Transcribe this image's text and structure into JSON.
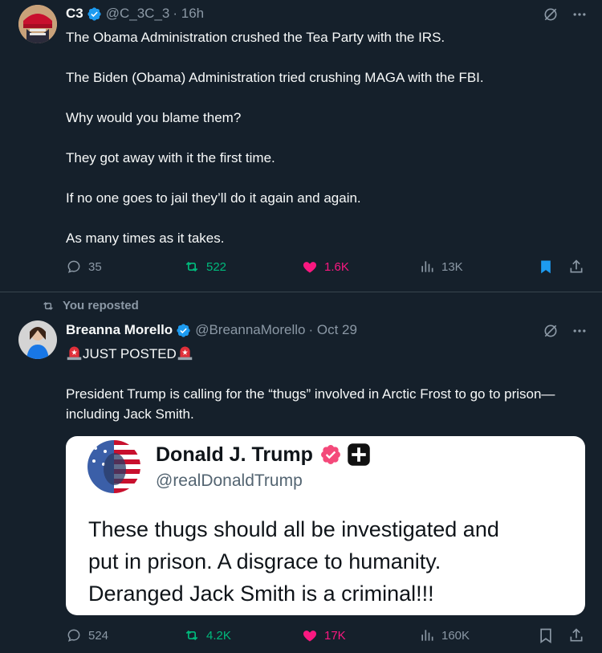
{
  "posts": [
    {
      "display_name": "C3",
      "handle": "@C_3C_3",
      "time": "· 16h",
      "lines": [
        "The Obama Administration crushed the Tea Party with the IRS.",
        "The Biden (Obama) Administration tried crushing MAGA with the FBI.",
        "Why would you blame them?",
        "They got away with it the first time.",
        "If no one goes to jail they’ll do it again and again.",
        "As many times as it takes."
      ],
      "actions": {
        "replies": "35",
        "reposts": "522",
        "likes": "1.6K",
        "views": "13K"
      }
    },
    {
      "repost_label": "You reposted",
      "display_name": "Breanna Morello",
      "handle": "@BreannaMorello",
      "time": "· Oct 29",
      "headline": "JUST POSTED",
      "text": "President Trump is calling for the “thugs” involved in Arctic Frost to go to prison—including Jack Smith.",
      "quote": {
        "name": "Donald J. Trump",
        "handle": "@realDonaldTrump",
        "text_lines": [
          "These thugs should all be investigated and",
          "put in prison. A disgrace to humanity.",
          "Deranged Jack Smith is a criminal!!!"
        ]
      },
      "actions": {
        "replies": "524",
        "reposts": "4.2K",
        "likes": "17K",
        "views": "160K"
      }
    }
  ],
  "colors": {
    "background": "#15202b",
    "text": "#f7f9f9",
    "muted": "#8b98a5",
    "accent_blue": "#1d9bf0",
    "repost_green": "#00ba7c",
    "like_pink": "#f91880",
    "divider": "#38444d"
  },
  "icons": [
    "verified-badge-icon",
    "grok-icon",
    "more-icon",
    "reply-icon",
    "repost-icon",
    "like-icon",
    "views-icon",
    "bookmark-icon",
    "share-icon",
    "siren-emoji"
  ]
}
